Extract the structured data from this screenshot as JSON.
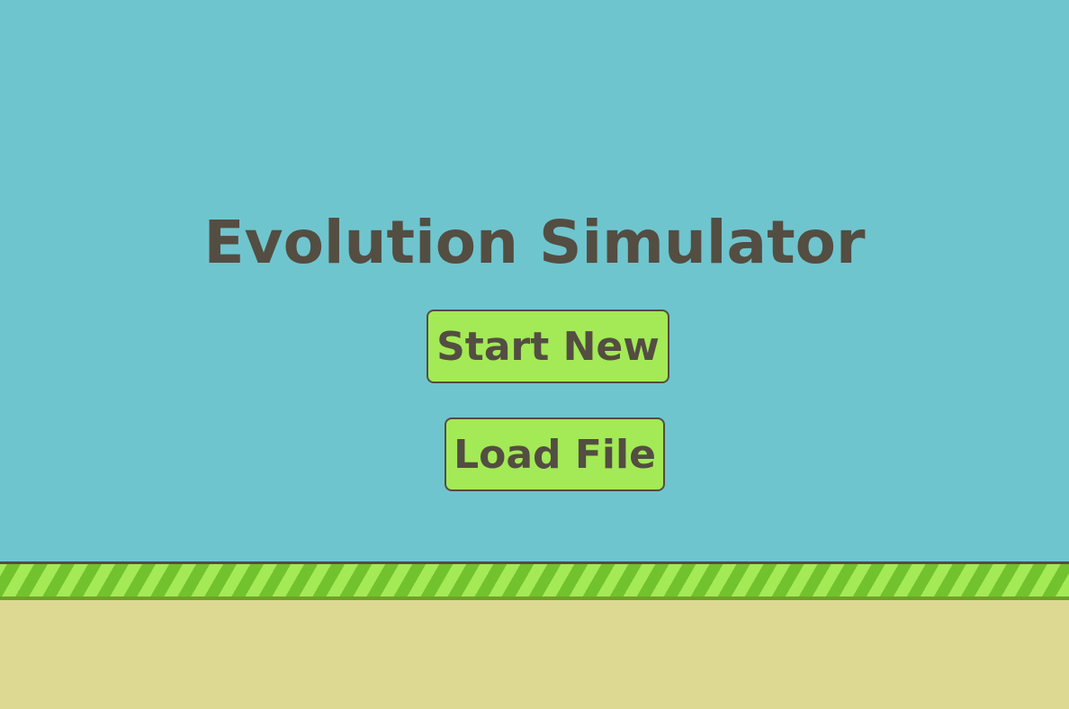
{
  "game": {
    "title": "Evolution Simulator"
  },
  "menu": {
    "start_new_label": "Start New",
    "load_file_label": "Load File"
  },
  "colors": {
    "sky": "#6fc5ce",
    "button_fill": "#a3ea56",
    "text_dark": "#544d42",
    "grass_light": "#a3ea56",
    "grass_dark": "#72c22e",
    "dirt": "#ddd993"
  }
}
